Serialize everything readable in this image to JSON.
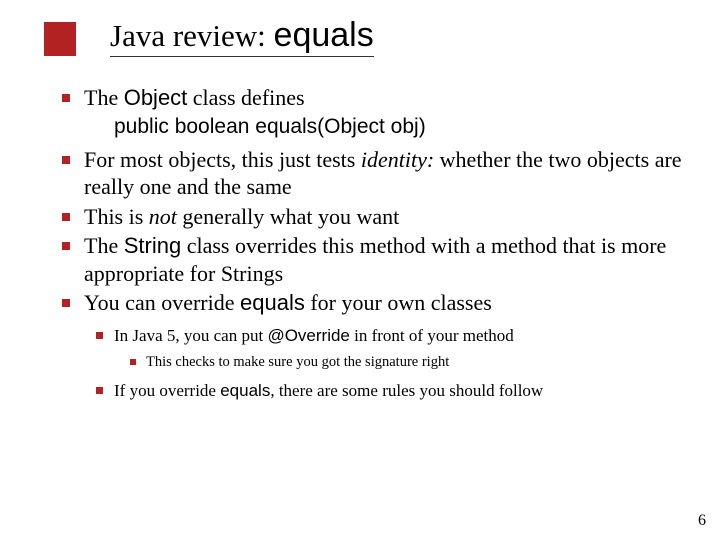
{
  "title_prefix": "Java review: ",
  "title_code": "equals",
  "bullets": [
    {
      "pre": "The ",
      "code": "Object",
      "post": " class defines"
    },
    {
      "method": "public boolean equals(Object obj)"
    },
    {
      "pre": "For most objects, this just tests ",
      "italic": "identity:",
      "post": " whether the two objects are really one and the same"
    },
    {
      "pre": "This is ",
      "italic": "not",
      "post": " generally what you want"
    },
    {
      "pre": "The ",
      "code": "String",
      "post": " class overrides this method with a method that is more appropriate for Strings"
    },
    {
      "pre": "You can override ",
      "code": "equals",
      "post": " for your own classes"
    }
  ],
  "sub_bullets": [
    {
      "pre": "In Java 5, you can put ",
      "code": "@Override",
      "post": " in front of your method"
    },
    {
      "text": "This checks to make sure you got the signature right"
    },
    {
      "pre": "If you override ",
      "code": "equals",
      "post": ", there are some rules you should follow"
    }
  ],
  "page_number": "6"
}
